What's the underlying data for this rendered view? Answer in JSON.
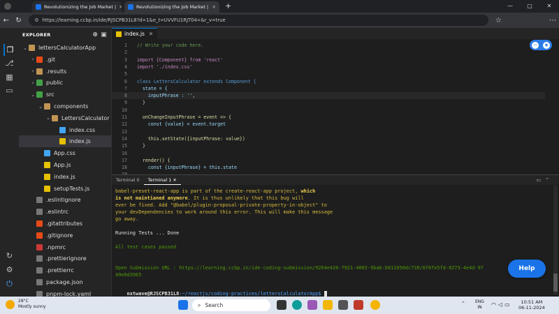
{
  "browser": {
    "tabs": [
      {
        "title": "Revolutionizing the Job Market |"
      },
      {
        "title": "Revolutionizing the Job Market |"
      }
    ],
    "new_tab": "+",
    "url": "https://learning.ccbp.in/ide/RJSCPB31L8?d=1&e_t=UVVFU1RJT04=&r_v=true",
    "window_controls": [
      "—",
      "▢",
      "✕"
    ]
  },
  "explorer": {
    "title": "EXPLORER",
    "tree": [
      {
        "label": "lettersCalculatorApp",
        "depth": 0,
        "kind": "folder",
        "open": true
      },
      {
        "label": ".git",
        "depth": 1,
        "kind": "git",
        "open": false
      },
      {
        "label": ".results",
        "depth": 1,
        "kind": "folder",
        "open": false
      },
      {
        "label": "public",
        "depth": 1,
        "kind": "green",
        "open": false
      },
      {
        "label": "src",
        "depth": 1,
        "kind": "green",
        "open": true
      },
      {
        "label": "components",
        "depth": 2,
        "kind": "folder",
        "open": true
      },
      {
        "label": "LettersCalculator",
        "depth": 3,
        "kind": "folder",
        "open": true
      },
      {
        "label": "index.css",
        "depth": 4,
        "kind": "css"
      },
      {
        "label": "index.js",
        "depth": 4,
        "kind": "js",
        "active": true
      },
      {
        "label": "App.css",
        "depth": 2,
        "kind": "css"
      },
      {
        "label": "App.js",
        "depth": 2,
        "kind": "js"
      },
      {
        "label": "index.js",
        "depth": 2,
        "kind": "js"
      },
      {
        "label": "setupTests.js",
        "depth": 2,
        "kind": "js"
      },
      {
        "label": ".eslintignore",
        "depth": 1,
        "kind": "file"
      },
      {
        "label": ".eslintrc",
        "depth": 1,
        "kind": "file"
      },
      {
        "label": ".gitattributes",
        "depth": 1,
        "kind": "git"
      },
      {
        "label": ".gitignore",
        "depth": 1,
        "kind": "git"
      },
      {
        "label": ".npmrc",
        "depth": 1,
        "kind": "npm"
      },
      {
        "label": ".prettierignore",
        "depth": 1,
        "kind": "file"
      },
      {
        "label": ".prettierrc",
        "depth": 1,
        "kind": "file"
      },
      {
        "label": "package.json",
        "depth": 1,
        "kind": "file"
      },
      {
        "label": "pnpm-lock.yaml",
        "depth": 1,
        "kind": "file"
      }
    ]
  },
  "editor": {
    "tab": "index.js",
    "lines": [
      {
        "n": "1",
        "text": "// Write your code here.",
        "color": "#6a9955"
      },
      {
        "n": "2",
        "text": "",
        "color": "#ccc"
      },
      {
        "n": "3",
        "text": "import {Component} from 'react'",
        "color": "#c586c0"
      },
      {
        "n": "4",
        "text": "import './index.css'",
        "color": "#c586c0"
      },
      {
        "n": "5",
        "text": "",
        "color": "#ccc"
      },
      {
        "n": "6",
        "text": "class LettersCalculator extends Component {",
        "color": "#569cd6"
      },
      {
        "n": "7",
        "text": "  state = {",
        "color": "#9cdcfe"
      },
      {
        "n": "8",
        "text": "    inputPhrase : '',",
        "color": "#9cdcfe",
        "current": true
      },
      {
        "n": "9",
        "text": "  }",
        "color": "#ccc"
      },
      {
        "n": "10",
        "text": "",
        "color": "#ccc"
      },
      {
        "n": "11",
        "text": "  onChangeInputPhrase = event => {",
        "color": "#dcdcaa"
      },
      {
        "n": "12",
        "text": "    const {value} = event.target",
        "color": "#9cdcfe"
      },
      {
        "n": "13",
        "text": "",
        "color": "#ccc"
      },
      {
        "n": "14",
        "text": "    this.setState({inputPhrase: value})",
        "color": "#dcdcaa"
      },
      {
        "n": "15",
        "text": "  }",
        "color": "#ccc"
      },
      {
        "n": "16",
        "text": "",
        "color": "#ccc"
      },
      {
        "n": "17",
        "text": "  render() {",
        "color": "#dcdcaa"
      },
      {
        "n": "18",
        "text": "    const {inputPhrase} = this.state",
        "color": "#9cdcfe"
      },
      {
        "n": "19",
        "text": "",
        "color": "#ccc"
      },
      {
        "n": "20",
        "text": "    return (",
        "color": "#c586c0"
      }
    ]
  },
  "terminal": {
    "tabs": [
      "Terminal 0",
      "Terminal 1"
    ],
    "close_label": "✕",
    "lines": [
      {
        "text": "babel-preset-react-app is part of the create-react-app project, which",
        "cls": "yellow"
      },
      {
        "text": "is not maintianed anymore. It is thus unlikely that this bug will",
        "cls": "yellow"
      },
      {
        "text": "ever be fixed. Add \"@babel/plugin-proposal-private-property-in-object\" to",
        "cls": "yellow"
      },
      {
        "text": "your devDependencies to work around this error. This will make this message",
        "cls": "yellow"
      },
      {
        "text": "go away.",
        "cls": "yellow"
      },
      {
        "text": "",
        "cls": "white"
      },
      {
        "text": "Running Tests ... Done",
        "cls": "white"
      },
      {
        "text": "",
        "cls": "white"
      },
      {
        "text": "All test cases passed",
        "cls": "green"
      },
      {
        "text": "",
        "cls": "white"
      },
      {
        "text": "",
        "cls": "white"
      },
      {
        "text": "Open Submission URL : https://learning.ccbp.in/ide-coding-submission/9264e426-7921-4065-9bab-b611050dc730/6f0fe5fd-0273-4e4d-97",
        "cls": "green"
      },
      {
        "text": "49e0d3965",
        "cls": "green"
      }
    ],
    "prompt_user": "nxtwave@RJSCPB31L8",
    "prompt_path": ":~/reactjs/coding-practices/lettersCalculatorApp$",
    "help_label": "Help"
  },
  "taskbar": {
    "weather_temp": "28°C",
    "weather_desc": "Mostly sunny",
    "search_placeholder": "Search",
    "lang_top": "ENG",
    "lang_bottom": "IN",
    "time": "10:51 AM",
    "date": "06-11-2024"
  }
}
